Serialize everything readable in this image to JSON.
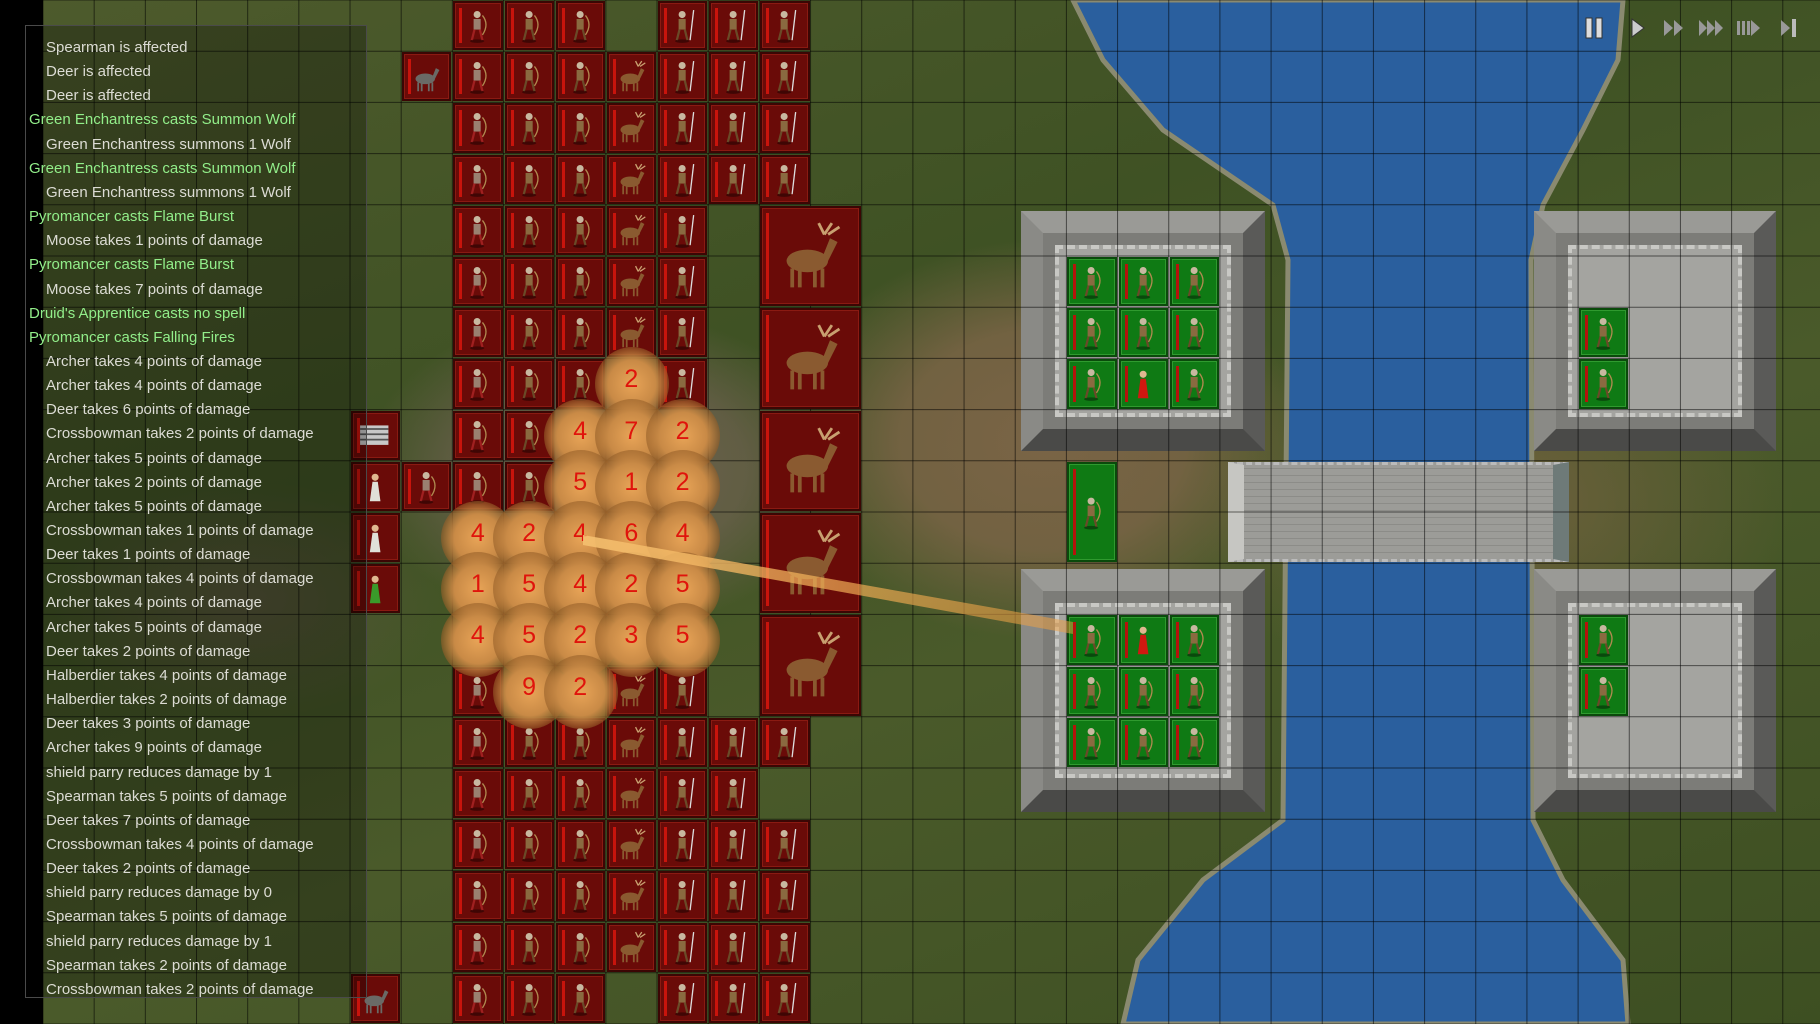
{
  "combat_log": [
    {
      "text": "Spearman is affected",
      "kind": "normal"
    },
    {
      "text": "Deer is affected",
      "kind": "normal"
    },
    {
      "text": "Deer is affected",
      "kind": "normal"
    },
    {
      "text": "Green Enchantress casts Summon Wolf",
      "kind": "spell"
    },
    {
      "text": "Green Enchantress summons 1 Wolf",
      "kind": "normal"
    },
    {
      "text": "Green Enchantress casts Summon Wolf",
      "kind": "spell"
    },
    {
      "text": "Green Enchantress summons 1 Wolf",
      "kind": "normal"
    },
    {
      "text": "Pyromancer casts Flame Burst",
      "kind": "spell"
    },
    {
      "text": "Moose takes 1 points of damage",
      "kind": "normal"
    },
    {
      "text": "Pyromancer casts Flame Burst",
      "kind": "spell"
    },
    {
      "text": "Moose takes 7 points of damage",
      "kind": "normal"
    },
    {
      "text": "Druid's Apprentice casts no spell",
      "kind": "spell"
    },
    {
      "text": "Pyromancer casts Falling Fires",
      "kind": "spell"
    },
    {
      "text": "Archer takes 4 points of damage",
      "kind": "normal"
    },
    {
      "text": "Archer takes 4 points of damage",
      "kind": "normal"
    },
    {
      "text": "Deer takes 6 points of damage",
      "kind": "normal"
    },
    {
      "text": "Crossbowman takes 2 points of damage",
      "kind": "normal"
    },
    {
      "text": "Archer takes 5 points of damage",
      "kind": "normal"
    },
    {
      "text": "Archer takes 2 points of damage",
      "kind": "normal"
    },
    {
      "text": "Archer takes 5 points of damage",
      "kind": "normal"
    },
    {
      "text": "Crossbowman takes 1 points of damage",
      "kind": "normal"
    },
    {
      "text": "Deer takes 1 points of damage",
      "kind": "normal"
    },
    {
      "text": "Crossbowman takes 4 points of damage",
      "kind": "normal"
    },
    {
      "text": "Archer takes 4 points of damage",
      "kind": "normal"
    },
    {
      "text": "Archer takes 5 points of damage",
      "kind": "normal"
    },
    {
      "text": "Deer takes 2 points of damage",
      "kind": "normal"
    },
    {
      "text": "Halberdier takes 4 points of damage",
      "kind": "normal"
    },
    {
      "text": "Halberdier takes 2 points of damage",
      "kind": "normal"
    },
    {
      "text": "Deer takes 3 points of damage",
      "kind": "normal"
    },
    {
      "text": "Archer takes 9 points of damage",
      "kind": "normal"
    },
    {
      "text": "shield parry reduces damage by 1",
      "kind": "normal"
    },
    {
      "text": "Spearman takes 5 points of damage",
      "kind": "normal"
    },
    {
      "text": "Deer takes 7 points of damage",
      "kind": "normal"
    },
    {
      "text": "Crossbowman takes 4 points of damage",
      "kind": "normal"
    },
    {
      "text": "Deer takes 2 points of damage",
      "kind": "normal"
    },
    {
      "text": "shield parry reduces damage by 0",
      "kind": "normal"
    },
    {
      "text": "Spearman takes 5 points of damage",
      "kind": "normal"
    },
    {
      "text": "shield parry reduces damage by 1",
      "kind": "normal"
    },
    {
      "text": "Spearman takes 2 points of damage",
      "kind": "normal"
    },
    {
      "text": "Crossbowman takes 2 points of damage",
      "kind": "normal"
    }
  ],
  "speed_controls": [
    {
      "name": "pause",
      "icon": "pause-icon",
      "active": true
    },
    {
      "name": "play",
      "icon": "play-icon",
      "active": false
    },
    {
      "name": "fast",
      "icon": "fast-forward-icon",
      "active": false
    },
    {
      "name": "faster",
      "icon": "faster-forward-icon",
      "active": false
    },
    {
      "name": "fastest",
      "icon": "fastest-forward-icon",
      "active": false
    },
    {
      "name": "step",
      "icon": "step-forward-icon",
      "active": false
    }
  ],
  "colors": {
    "red_team": "#6a0b08",
    "green_team": "#0f7a14",
    "water": "#2a5f9e",
    "damage_number": "#e0140c",
    "spell_log_text": "#92ee8a",
    "log_text": "#dcdcd4"
  },
  "red_army": {
    "column_units": {
      "8": "crossbowman",
      "9": "archer",
      "10": "archer",
      "11": "deer",
      "12": "spearman",
      "13": "halberdier",
      "14": "halberdier"
    },
    "rows": [
      {
        "row": 0,
        "cols": [
          8,
          9,
          10,
          12,
          13,
          14
        ]
      },
      {
        "row": 1,
        "cols": [
          8,
          9,
          10,
          11,
          12,
          13,
          14
        ]
      },
      {
        "row": 2,
        "cols": [
          8,
          9,
          10,
          11,
          12,
          13,
          14
        ]
      },
      {
        "row": 3,
        "cols": [
          8,
          9,
          10,
          11,
          12,
          13,
          14
        ]
      },
      {
        "row": 4,
        "cols": [
          8,
          9,
          10,
          11,
          12
        ]
      },
      {
        "row": 5,
        "cols": [
          8,
          9,
          10,
          11,
          12
        ]
      },
      {
        "row": 6,
        "cols": [
          8,
          9,
          10,
          11,
          12
        ]
      },
      {
        "row": 7,
        "cols": [
          8,
          9,
          10,
          12
        ]
      },
      {
        "row": 8,
        "cols": [
          8,
          9
        ]
      },
      {
        "row": 9,
        "cols": [
          8,
          9
        ]
      },
      {
        "row": 13,
        "cols": [
          8,
          11,
          12
        ]
      },
      {
        "row": 14,
        "cols": [
          8,
          9,
          10,
          11,
          12,
          13,
          14
        ]
      },
      {
        "row": 15,
        "cols": [
          8,
          9,
          10,
          11,
          12,
          13
        ]
      },
      {
        "row": 16,
        "cols": [
          8,
          9,
          10,
          11,
          12,
          13,
          14
        ]
      },
      {
        "row": 17,
        "cols": [
          8,
          9,
          10,
          11,
          12,
          13,
          14
        ]
      },
      {
        "row": 18,
        "cols": [
          8,
          9,
          10,
          11,
          12,
          13,
          14
        ]
      },
      {
        "row": 19,
        "cols": [
          8,
          9,
          10,
          12,
          13,
          14
        ]
      }
    ],
    "extra_units": [
      {
        "row": 1,
        "col": 7,
        "unit": "wolf"
      },
      {
        "row": 8,
        "col": 6,
        "unit": "war-wagon"
      },
      {
        "row": 9,
        "col": 6,
        "unit": "priest"
      },
      {
        "row": 9,
        "col": 7,
        "unit": "crossbowman"
      },
      {
        "row": 10,
        "col": 6,
        "unit": "priest"
      },
      {
        "row": 11,
        "col": 6,
        "unit": "green-enchantress"
      },
      {
        "row": 19,
        "col": 6,
        "unit": "wolf"
      }
    ],
    "moose": [
      {
        "row": 4,
        "col": 14
      },
      {
        "row": 6,
        "col": 14
      },
      {
        "row": 8,
        "col": 14
      },
      {
        "row": 10,
        "col": 14
      },
      {
        "row": 12,
        "col": 14
      }
    ]
  },
  "green_army": [
    {
      "row": 5,
      "col": 20,
      "unit": "archer"
    },
    {
      "row": 5,
      "col": 21,
      "unit": "archer"
    },
    {
      "row": 5,
      "col": 22,
      "unit": "archer"
    },
    {
      "row": 6,
      "col": 20,
      "unit": "archer"
    },
    {
      "row": 6,
      "col": 21,
      "unit": "archer"
    },
    {
      "row": 6,
      "col": 22,
      "unit": "archer"
    },
    {
      "row": 7,
      "col": 20,
      "unit": "archer"
    },
    {
      "row": 7,
      "col": 21,
      "unit": "pyromancer"
    },
    {
      "row": 7,
      "col": 22,
      "unit": "archer"
    },
    {
      "row": 12,
      "col": 20,
      "unit": "archer"
    },
    {
      "row": 12,
      "col": 21,
      "unit": "pyromancer"
    },
    {
      "row": 12,
      "col": 22,
      "unit": "archer"
    },
    {
      "row": 13,
      "col": 20,
      "unit": "archer"
    },
    {
      "row": 13,
      "col": 21,
      "unit": "archer"
    },
    {
      "row": 13,
      "col": 22,
      "unit": "archer"
    },
    {
      "row": 14,
      "col": 20,
      "unit": "archer"
    },
    {
      "row": 14,
      "col": 21,
      "unit": "archer"
    },
    {
      "row": 14,
      "col": 22,
      "unit": "archer"
    },
    {
      "row": 6,
      "col": 30,
      "unit": "archer"
    },
    {
      "row": 7,
      "col": 30,
      "unit": "archer"
    },
    {
      "row": 12,
      "col": 30,
      "unit": "archer"
    },
    {
      "row": 13,
      "col": 30,
      "unit": "archer"
    },
    {
      "row": 9,
      "col": 20,
      "unit": "pikemen",
      "tall": true
    }
  ],
  "falling_fires_damage": [
    {
      "row": 7,
      "col": 11,
      "value": "2"
    },
    {
      "row": 8,
      "col": 10,
      "value": "4"
    },
    {
      "row": 8,
      "col": 11,
      "value": "7"
    },
    {
      "row": 8,
      "col": 12,
      "value": "2"
    },
    {
      "row": 9,
      "col": 10,
      "value": "5"
    },
    {
      "row": 9,
      "col": 11,
      "value": "1"
    },
    {
      "row": 9,
      "col": 12,
      "value": "2"
    },
    {
      "row": 10,
      "col": 8,
      "value": "4"
    },
    {
      "row": 10,
      "col": 9,
      "value": "2"
    },
    {
      "row": 10,
      "col": 10,
      "value": "4"
    },
    {
      "row": 10,
      "col": 11,
      "value": "6"
    },
    {
      "row": 10,
      "col": 12,
      "value": "4"
    },
    {
      "row": 11,
      "col": 8,
      "value": "1"
    },
    {
      "row": 11,
      "col": 9,
      "value": "5"
    },
    {
      "row": 11,
      "col": 10,
      "value": "4"
    },
    {
      "row": 11,
      "col": 11,
      "value": "2"
    },
    {
      "row": 11,
      "col": 12,
      "value": "5"
    },
    {
      "row": 12,
      "col": 8,
      "value": "4"
    },
    {
      "row": 12,
      "col": 9,
      "value": "5"
    },
    {
      "row": 12,
      "col": 10,
      "value": "2"
    },
    {
      "row": 12,
      "col": 11,
      "value": "3"
    },
    {
      "row": 12,
      "col": 12,
      "value": "5"
    },
    {
      "row": 13,
      "col": 9,
      "value": "9"
    },
    {
      "row": 13,
      "col": 10,
      "value": "2"
    }
  ]
}
